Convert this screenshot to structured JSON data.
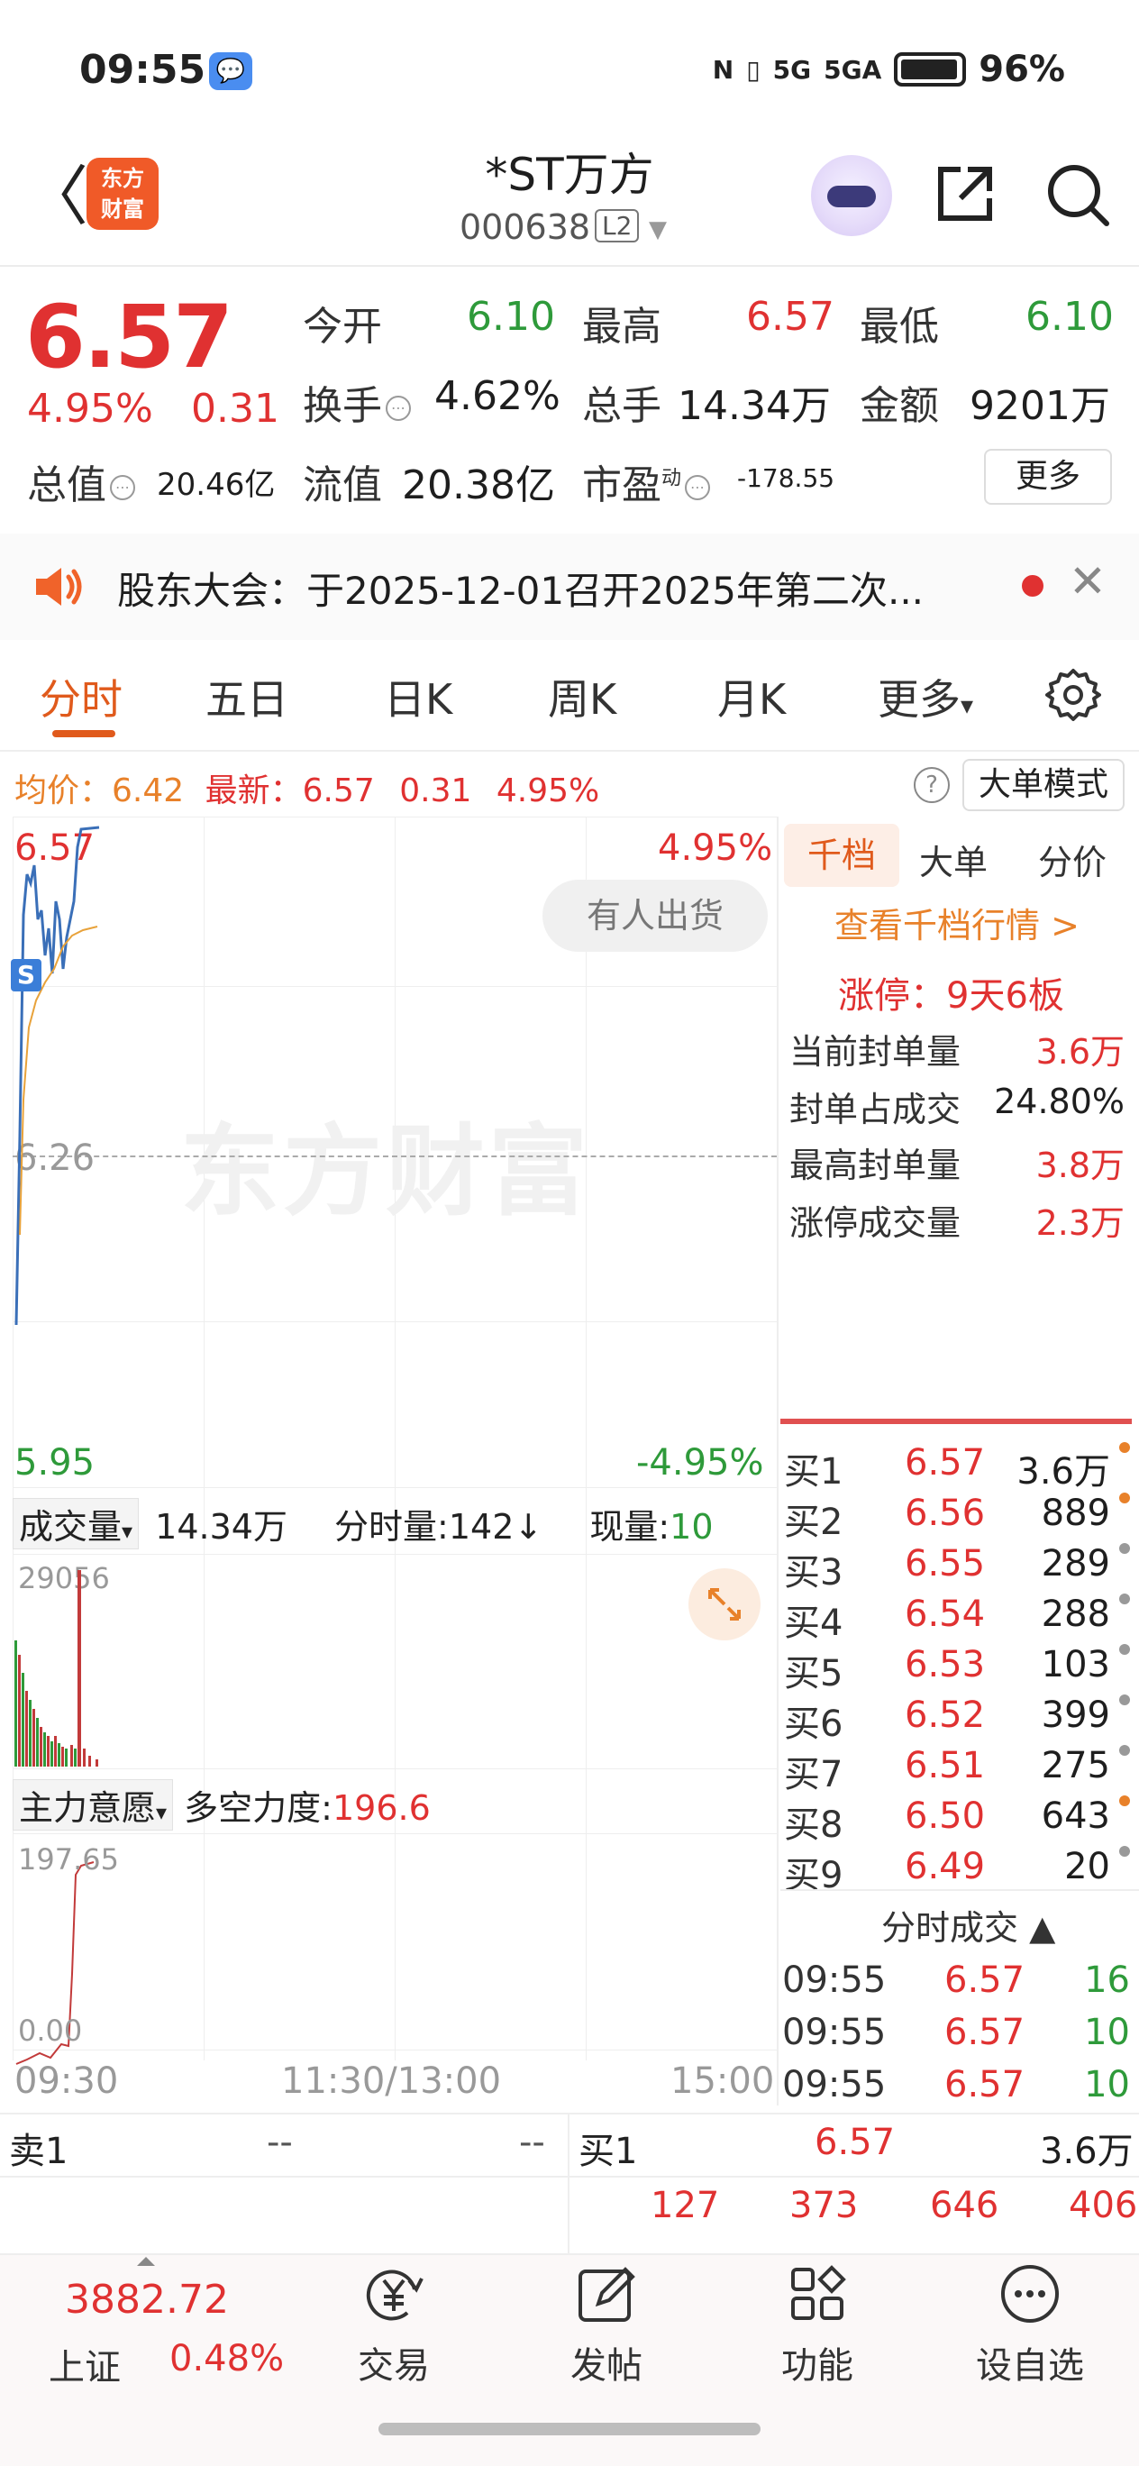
{
  "status_bar": {
    "time": "09:55",
    "msg_glyph": "💬",
    "nfc_icon": "N",
    "vibrate_icon": "▯",
    "network1": "5G",
    "network2": "5GA",
    "battery_pct": "96%"
  },
  "header": {
    "back_glyph": "〈",
    "logo_line1": "东方",
    "logo_line2": "财富",
    "stock_name": "*ST万方",
    "stock_code": "000638",
    "level_badge": "L2",
    "caret": "▼"
  },
  "quote": {
    "price": "6.57",
    "change_pct": "4.95%",
    "change_amt": "0.31",
    "open_label": "今开",
    "open_value": "6.10",
    "high_label": "最高",
    "high_value": "6.57",
    "low_label": "最低",
    "low_value": "6.10",
    "turnover_label": "换手",
    "turnover_value": "4.62%",
    "volume_label": "总手",
    "volume_value": "14.34万",
    "amount_label": "金额",
    "amount_value": "9201万",
    "mktcap_label": "总值",
    "mktcap_value": "20.46亿",
    "float_label": "流值",
    "float_value": "20.38亿",
    "pe_label": "市盈",
    "pe_sup": "动",
    "pe_value": "-178.55",
    "more_label": "更多"
  },
  "notice": {
    "text": "股东大会：于2025-12-01召开2025年第二次...",
    "close_glyph": "✕"
  },
  "tabs": {
    "items": [
      "分时",
      "五日",
      "日K",
      "周K",
      "月K",
      "更多"
    ],
    "more_caret": "▾"
  },
  "chart_header": {
    "avg_label": "均价：",
    "avg_value": "6.42",
    "latest_label": "最新：",
    "latest_price": "6.57",
    "latest_chg": "0.31",
    "latest_pct": "4.95%",
    "help_glyph": "?",
    "big_order_label": "大单模式"
  },
  "chart": {
    "y_top_left": "6.57",
    "y_top_right": "4.95%",
    "y_mid_left": "6.26",
    "y_bot_left": "5.95",
    "y_bot_right": "-4.95%",
    "watermark": "东方财富",
    "bubble": "有人出货",
    "s_marker": "S",
    "x_start": "09:30",
    "x_mid": "11:30/13:00",
    "x_end": "15:00"
  },
  "volume_panel": {
    "selector_label": "成交量",
    "selector_caret": "▾",
    "total": "14.34万",
    "minute_label": "分时量:",
    "minute_value": "142",
    "minute_arrow": "↓",
    "now_label": "现量:",
    "now_value": "10",
    "max_value": "29056"
  },
  "force_panel": {
    "selector_label": "主力意愿",
    "selector_caret": "▾",
    "label": "多空力度:",
    "value": "196.6",
    "max_value": "197.65",
    "min_value": "0.00"
  },
  "right_panel": {
    "tabs": [
      "千档",
      "大单",
      "分价"
    ],
    "view_link": "查看千档行情 >",
    "limit_up_title": "涨停：9天6板",
    "stats": [
      {
        "label": "当前封单量",
        "value": "3.6万",
        "color": "#e03131"
      },
      {
        "label": "封单占成交",
        "value": "24.80%",
        "color": "#1e1e1e"
      },
      {
        "label": "最高封单量",
        "value": "3.8万",
        "color": "#e03131"
      },
      {
        "label": "涨停成交量",
        "value": "2.3万",
        "color": "#e03131"
      }
    ],
    "bids": [
      {
        "label": "买1",
        "price": "6.57",
        "vol": "3.6万",
        "dot": "orange"
      },
      {
        "label": "买2",
        "price": "6.56",
        "vol": "889",
        "dot": "orange"
      },
      {
        "label": "买3",
        "price": "6.55",
        "vol": "289",
        "dot": "gray"
      },
      {
        "label": "买4",
        "price": "6.54",
        "vol": "288",
        "dot": "gray"
      },
      {
        "label": "买5",
        "price": "6.53",
        "vol": "103",
        "dot": "gray"
      },
      {
        "label": "买6",
        "price": "6.52",
        "vol": "399",
        "dot": "gray"
      },
      {
        "label": "买7",
        "price": "6.51",
        "vol": "275",
        "dot": "gray"
      },
      {
        "label": "买8",
        "price": "6.50",
        "vol": "643",
        "dot": "orange"
      },
      {
        "label": "买9",
        "price": "6.49",
        "vol": "20",
        "dot": "gray"
      }
    ],
    "ticks_title": "分时成交 ▲",
    "ticks": [
      {
        "time": "09:55",
        "price": "6.57",
        "vol": "16"
      },
      {
        "time": "09:55",
        "price": "6.57",
        "vol": "10"
      },
      {
        "time": "09:55",
        "price": "6.57",
        "vol": "10"
      }
    ]
  },
  "summary": {
    "ask_label": "卖1",
    "ask_price": "--",
    "ask_vol": "--",
    "bid_label": "买1",
    "bid_price": "6.57",
    "bid_vol": "3.6万",
    "queue": [
      "127",
      "373",
      "646",
      "406"
    ]
  },
  "bottom_nav": {
    "index_value": "3882.72",
    "index_name": "上证",
    "index_pct": "0.48%",
    "items": [
      "交易",
      "发帖",
      "功能",
      "设自选"
    ]
  },
  "colors": {
    "up": "#e03131",
    "down": "#2e9a3a",
    "accent": "#e05a1c",
    "avg_line": "#e8a23a",
    "price_line": "#3a6fb8"
  }
}
